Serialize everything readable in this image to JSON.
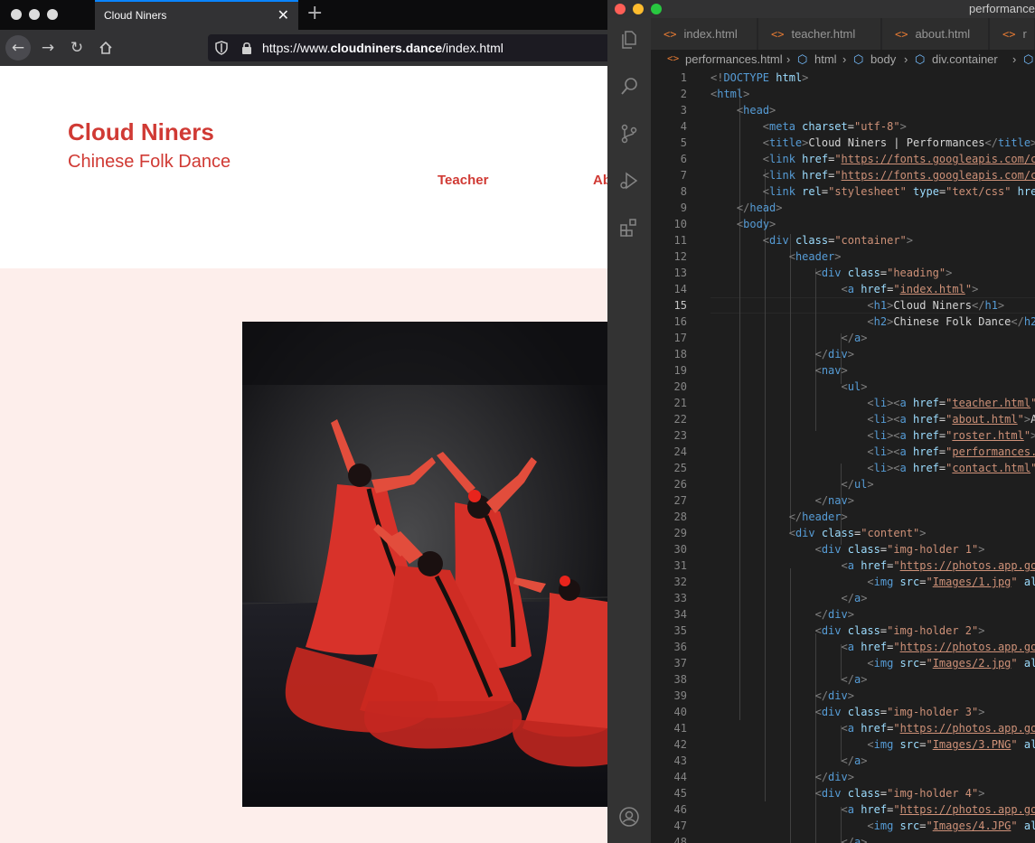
{
  "browser": {
    "tab_title": "Cloud Niners",
    "url_prefix": "https://www.",
    "url_domain": "cloudniners.dance",
    "url_path": "/index.html",
    "icons": [
      "back-arrow-icon",
      "forward-arrow-icon",
      "reload-icon",
      "home-icon",
      "shield-icon",
      "lock-icon",
      "close-icon",
      "plus-icon"
    ]
  },
  "site": {
    "title": "Cloud Niners",
    "subtitle": "Chinese Folk Dance",
    "nav": [
      "Teacher",
      "Ab"
    ]
  },
  "editor": {
    "window_title": "performance",
    "tabs": [
      "index.html",
      "teacher.html",
      "about.html",
      "r"
    ],
    "breadcrumb": [
      "performances.html",
      "html",
      "body",
      "div.container"
    ],
    "current_line": 15,
    "lines": [
      [
        [
          "p",
          "<!"
        ],
        [
          "t",
          "DOCTYPE"
        ],
        [
          "w",
          " "
        ],
        [
          "a",
          "html"
        ],
        [
          "p",
          ">"
        ]
      ],
      [
        [
          "p",
          "<"
        ],
        [
          "t",
          "html"
        ],
        [
          "p",
          ">"
        ]
      ],
      [
        [
          "w",
          "    "
        ],
        [
          "p",
          "<"
        ],
        [
          "t",
          "head"
        ],
        [
          "p",
          ">"
        ]
      ],
      [
        [
          "w",
          "        "
        ],
        [
          "p",
          "<"
        ],
        [
          "t",
          "meta"
        ],
        [
          "w",
          " "
        ],
        [
          "a",
          "charset"
        ],
        [
          "w",
          "="
        ],
        [
          "s",
          "\"utf-8\""
        ],
        [
          "p",
          ">"
        ]
      ],
      [
        [
          "w",
          "        "
        ],
        [
          "p",
          "<"
        ],
        [
          "t",
          "title"
        ],
        [
          "p",
          ">"
        ],
        [
          "w",
          "Cloud Niners | Performances"
        ],
        [
          "p",
          "</"
        ],
        [
          "t",
          "title"
        ],
        [
          "p",
          ">"
        ]
      ],
      [
        [
          "w",
          "        "
        ],
        [
          "p",
          "<"
        ],
        [
          "t",
          "link"
        ],
        [
          "w",
          " "
        ],
        [
          "a",
          "href"
        ],
        [
          "w",
          "="
        ],
        [
          "s",
          "\""
        ],
        [
          "u",
          "https://fonts.googleapis.com/c"
        ]
      ],
      [
        [
          "w",
          "        "
        ],
        [
          "p",
          "<"
        ],
        [
          "t",
          "link"
        ],
        [
          "w",
          " "
        ],
        [
          "a",
          "href"
        ],
        [
          "w",
          "="
        ],
        [
          "s",
          "\""
        ],
        [
          "u",
          "https://fonts.googleapis.com/c"
        ]
      ],
      [
        [
          "w",
          "        "
        ],
        [
          "p",
          "<"
        ],
        [
          "t",
          "link"
        ],
        [
          "w",
          " "
        ],
        [
          "a",
          "rel"
        ],
        [
          "w",
          "="
        ],
        [
          "s",
          "\"stylesheet\""
        ],
        [
          "w",
          " "
        ],
        [
          "a",
          "type"
        ],
        [
          "w",
          "="
        ],
        [
          "s",
          "\"text/css\""
        ],
        [
          "w",
          " "
        ],
        [
          "a",
          "hre"
        ]
      ],
      [
        [
          "w",
          "    "
        ],
        [
          "p",
          "</"
        ],
        [
          "t",
          "head"
        ],
        [
          "p",
          ">"
        ]
      ],
      [
        [
          "w",
          "    "
        ],
        [
          "p",
          "<"
        ],
        [
          "t",
          "body"
        ],
        [
          "p",
          ">"
        ]
      ],
      [
        [
          "w",
          "        "
        ],
        [
          "p",
          "<"
        ],
        [
          "t",
          "div"
        ],
        [
          "w",
          " "
        ],
        [
          "a",
          "class"
        ],
        [
          "w",
          "="
        ],
        [
          "s",
          "\"container\""
        ],
        [
          "p",
          ">"
        ]
      ],
      [
        [
          "w",
          "            "
        ],
        [
          "p",
          "<"
        ],
        [
          "t",
          "header"
        ],
        [
          "p",
          ">"
        ]
      ],
      [
        [
          "w",
          "                "
        ],
        [
          "p",
          "<"
        ],
        [
          "t",
          "div"
        ],
        [
          "w",
          " "
        ],
        [
          "a",
          "class"
        ],
        [
          "w",
          "="
        ],
        [
          "s",
          "\"heading\""
        ],
        [
          "p",
          ">"
        ]
      ],
      [
        [
          "w",
          "                    "
        ],
        [
          "p",
          "<"
        ],
        [
          "t",
          "a"
        ],
        [
          "w",
          " "
        ],
        [
          "a",
          "href"
        ],
        [
          "w",
          "="
        ],
        [
          "s",
          "\""
        ],
        [
          "u",
          "index.html"
        ],
        [
          "s",
          "\""
        ],
        [
          "p",
          ">"
        ]
      ],
      [
        [
          "w",
          "                        "
        ],
        [
          "p",
          "<"
        ],
        [
          "t",
          "h1"
        ],
        [
          "p",
          ">"
        ],
        [
          "w",
          "Cloud Niners"
        ],
        [
          "p",
          "</"
        ],
        [
          "t",
          "h1"
        ],
        [
          "p",
          ">"
        ]
      ],
      [
        [
          "w",
          "                        "
        ],
        [
          "p",
          "<"
        ],
        [
          "t",
          "h2"
        ],
        [
          "p",
          ">"
        ],
        [
          "w",
          "Chinese Folk Dance"
        ],
        [
          "p",
          "</"
        ],
        [
          "t",
          "h2"
        ]
      ],
      [
        [
          "w",
          "                    "
        ],
        [
          "p",
          "</"
        ],
        [
          "t",
          "a"
        ],
        [
          "p",
          ">"
        ]
      ],
      [
        [
          "w",
          "                "
        ],
        [
          "p",
          "</"
        ],
        [
          "t",
          "div"
        ],
        [
          "p",
          ">"
        ]
      ],
      [
        [
          "w",
          "                "
        ],
        [
          "p",
          "<"
        ],
        [
          "t",
          "nav"
        ],
        [
          "p",
          ">"
        ]
      ],
      [
        [
          "w",
          "                    "
        ],
        [
          "p",
          "<"
        ],
        [
          "t",
          "ul"
        ],
        [
          "p",
          ">"
        ]
      ],
      [
        [
          "w",
          "                        "
        ],
        [
          "p",
          "<"
        ],
        [
          "t",
          "li"
        ],
        [
          "p",
          "><"
        ],
        [
          "t",
          "a"
        ],
        [
          "w",
          " "
        ],
        [
          "a",
          "href"
        ],
        [
          "w",
          "="
        ],
        [
          "s",
          "\""
        ],
        [
          "u",
          "teacher.html"
        ],
        [
          "s",
          "\""
        ]
      ],
      [
        [
          "w",
          "                        "
        ],
        [
          "p",
          "<"
        ],
        [
          "t",
          "li"
        ],
        [
          "p",
          "><"
        ],
        [
          "t",
          "a"
        ],
        [
          "w",
          " "
        ],
        [
          "a",
          "href"
        ],
        [
          "w",
          "="
        ],
        [
          "s",
          "\""
        ],
        [
          "u",
          "about.html"
        ],
        [
          "s",
          "\""
        ],
        [
          "p",
          ">"
        ],
        [
          "w",
          "A"
        ]
      ],
      [
        [
          "w",
          "                        "
        ],
        [
          "p",
          "<"
        ],
        [
          "t",
          "li"
        ],
        [
          "p",
          "><"
        ],
        [
          "t",
          "a"
        ],
        [
          "w",
          " "
        ],
        [
          "a",
          "href"
        ],
        [
          "w",
          "="
        ],
        [
          "s",
          "\""
        ],
        [
          "u",
          "roster.html"
        ],
        [
          "s",
          "\""
        ],
        [
          "p",
          ">"
        ]
      ],
      [
        [
          "w",
          "                        "
        ],
        [
          "p",
          "<"
        ],
        [
          "t",
          "li"
        ],
        [
          "p",
          "><"
        ],
        [
          "t",
          "a"
        ],
        [
          "w",
          " "
        ],
        [
          "a",
          "href"
        ],
        [
          "w",
          "="
        ],
        [
          "s",
          "\""
        ],
        [
          "u",
          "performances."
        ]
      ],
      [
        [
          "w",
          "                        "
        ],
        [
          "p",
          "<"
        ],
        [
          "t",
          "li"
        ],
        [
          "p",
          "><"
        ],
        [
          "t",
          "a"
        ],
        [
          "w",
          " "
        ],
        [
          "a",
          "href"
        ],
        [
          "w",
          "="
        ],
        [
          "s",
          "\""
        ],
        [
          "u",
          "contact.html"
        ],
        [
          "s",
          "\""
        ]
      ],
      [
        [
          "w",
          "                    "
        ],
        [
          "p",
          "</"
        ],
        [
          "t",
          "ul"
        ],
        [
          "p",
          ">"
        ]
      ],
      [
        [
          "w",
          "                "
        ],
        [
          "p",
          "</"
        ],
        [
          "t",
          "nav"
        ],
        [
          "p",
          ">"
        ]
      ],
      [
        [
          "w",
          "            "
        ],
        [
          "p",
          "</"
        ],
        [
          "t",
          "header"
        ],
        [
          "p",
          ">"
        ]
      ],
      [
        [
          "w",
          "            "
        ],
        [
          "p",
          "<"
        ],
        [
          "t",
          "div"
        ],
        [
          "w",
          " "
        ],
        [
          "a",
          "class"
        ],
        [
          "w",
          "="
        ],
        [
          "s",
          "\"content\""
        ],
        [
          "p",
          ">"
        ]
      ],
      [
        [
          "w",
          "                "
        ],
        [
          "p",
          "<"
        ],
        [
          "t",
          "div"
        ],
        [
          "w",
          " "
        ],
        [
          "a",
          "class"
        ],
        [
          "w",
          "="
        ],
        [
          "s",
          "\"img-holder 1\""
        ],
        [
          "p",
          ">"
        ]
      ],
      [
        [
          "w",
          "                    "
        ],
        [
          "p",
          "<"
        ],
        [
          "t",
          "a"
        ],
        [
          "w",
          " "
        ],
        [
          "a",
          "href"
        ],
        [
          "w",
          "="
        ],
        [
          "s",
          "\""
        ],
        [
          "u",
          "https://photos.app.go"
        ]
      ],
      [
        [
          "w",
          "                        "
        ],
        [
          "p",
          "<"
        ],
        [
          "t",
          "img"
        ],
        [
          "w",
          " "
        ],
        [
          "a",
          "src"
        ],
        [
          "w",
          "="
        ],
        [
          "s",
          "\""
        ],
        [
          "u",
          "Images/1.jpg"
        ],
        [
          "s",
          "\""
        ],
        [
          "w",
          " "
        ],
        [
          "a",
          "al"
        ]
      ],
      [
        [
          "w",
          "                    "
        ],
        [
          "p",
          "</"
        ],
        [
          "t",
          "a"
        ],
        [
          "p",
          ">"
        ]
      ],
      [
        [
          "w",
          "                "
        ],
        [
          "p",
          "</"
        ],
        [
          "t",
          "div"
        ],
        [
          "p",
          ">"
        ]
      ],
      [
        [
          "w",
          "                "
        ],
        [
          "p",
          "<"
        ],
        [
          "t",
          "div"
        ],
        [
          "w",
          " "
        ],
        [
          "a",
          "class"
        ],
        [
          "w",
          "="
        ],
        [
          "s",
          "\"img-holder 2\""
        ],
        [
          "p",
          ">"
        ]
      ],
      [
        [
          "w",
          "                    "
        ],
        [
          "p",
          "<"
        ],
        [
          "t",
          "a"
        ],
        [
          "w",
          " "
        ],
        [
          "a",
          "href"
        ],
        [
          "w",
          "="
        ],
        [
          "s",
          "\""
        ],
        [
          "u",
          "https://photos.app.go"
        ]
      ],
      [
        [
          "w",
          "                        "
        ],
        [
          "p",
          "<"
        ],
        [
          "t",
          "img"
        ],
        [
          "w",
          " "
        ],
        [
          "a",
          "src"
        ],
        [
          "w",
          "="
        ],
        [
          "s",
          "\""
        ],
        [
          "u",
          "Images/2.jpg"
        ],
        [
          "s",
          "\""
        ],
        [
          "w",
          " "
        ],
        [
          "a",
          "al"
        ]
      ],
      [
        [
          "w",
          "                    "
        ],
        [
          "p",
          "</"
        ],
        [
          "t",
          "a"
        ],
        [
          "p",
          ">"
        ]
      ],
      [
        [
          "w",
          "                "
        ],
        [
          "p",
          "</"
        ],
        [
          "t",
          "div"
        ],
        [
          "p",
          ">"
        ]
      ],
      [
        [
          "w",
          "                "
        ],
        [
          "p",
          "<"
        ],
        [
          "t",
          "div"
        ],
        [
          "w",
          " "
        ],
        [
          "a",
          "class"
        ],
        [
          "w",
          "="
        ],
        [
          "s",
          "\"img-holder 3\""
        ],
        [
          "p",
          ">"
        ]
      ],
      [
        [
          "w",
          "                    "
        ],
        [
          "p",
          "<"
        ],
        [
          "t",
          "a"
        ],
        [
          "w",
          " "
        ],
        [
          "a",
          "href"
        ],
        [
          "w",
          "="
        ],
        [
          "s",
          "\""
        ],
        [
          "u",
          "https://photos.app.go"
        ]
      ],
      [
        [
          "w",
          "                        "
        ],
        [
          "p",
          "<"
        ],
        [
          "t",
          "img"
        ],
        [
          "w",
          " "
        ],
        [
          "a",
          "src"
        ],
        [
          "w",
          "="
        ],
        [
          "s",
          "\""
        ],
        [
          "u",
          "Images/3.PNG"
        ],
        [
          "s",
          "\""
        ],
        [
          "w",
          " "
        ],
        [
          "a",
          "al"
        ]
      ],
      [
        [
          "w",
          "                    "
        ],
        [
          "p",
          "</"
        ],
        [
          "t",
          "a"
        ],
        [
          "p",
          ">"
        ]
      ],
      [
        [
          "w",
          "                "
        ],
        [
          "p",
          "</"
        ],
        [
          "t",
          "div"
        ],
        [
          "p",
          ">"
        ]
      ],
      [
        [
          "w",
          "                "
        ],
        [
          "p",
          "<"
        ],
        [
          "t",
          "div"
        ],
        [
          "w",
          " "
        ],
        [
          "a",
          "class"
        ],
        [
          "w",
          "="
        ],
        [
          "s",
          "\"img-holder 4\""
        ],
        [
          "p",
          ">"
        ]
      ],
      [
        [
          "w",
          "                    "
        ],
        [
          "p",
          "<"
        ],
        [
          "t",
          "a"
        ],
        [
          "w",
          " "
        ],
        [
          "a",
          "href"
        ],
        [
          "w",
          "="
        ],
        [
          "s",
          "\""
        ],
        [
          "u",
          "https://photos.app.go"
        ]
      ],
      [
        [
          "w",
          "                        "
        ],
        [
          "p",
          "<"
        ],
        [
          "t",
          "img"
        ],
        [
          "w",
          " "
        ],
        [
          "a",
          "src"
        ],
        [
          "w",
          "="
        ],
        [
          "s",
          "\""
        ],
        [
          "u",
          "Images/4.JPG"
        ],
        [
          "s",
          "\""
        ],
        [
          "w",
          " "
        ],
        [
          "a",
          "al"
        ]
      ],
      [
        [
          "w",
          "                    "
        ],
        [
          "p",
          "</"
        ],
        [
          "t",
          "a"
        ],
        [
          "p",
          ">"
        ]
      ]
    ]
  },
  "colors": {
    "site_red": "#d03a34",
    "content_bg": "#fdeeeb",
    "editor_bg": "#1e1e1e"
  }
}
